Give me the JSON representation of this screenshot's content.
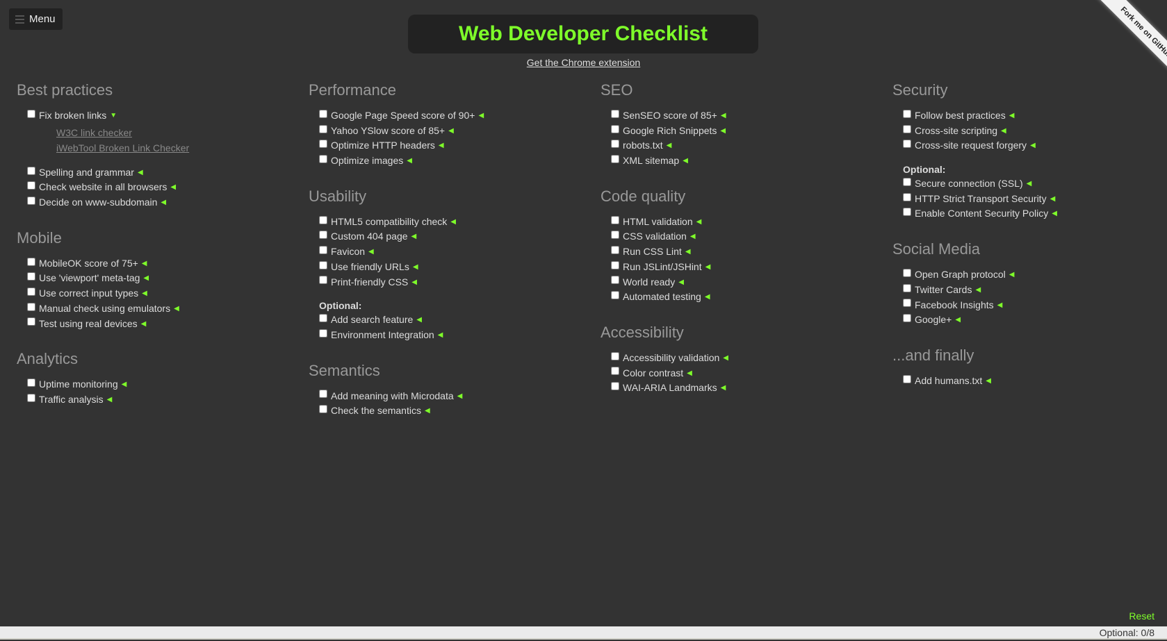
{
  "menu": {
    "label": "Menu",
    "icon": "list-icon"
  },
  "header": {
    "title": "Web Developer Checklist",
    "extension_link": "Get the Chrome extension"
  },
  "ribbon": {
    "label": "Fork me on GitHub"
  },
  "colors": {
    "accent": "#7fff2a",
    "background": "#333333",
    "heading": "#999999"
  },
  "columns": [
    [
      {
        "title": "Best practices",
        "items": [
          {
            "label": "Fix broken links",
            "expanded": true,
            "links": [
              "W3C link checker",
              "iWebTool Broken Link Checker"
            ]
          },
          {
            "label": "Spelling and grammar"
          },
          {
            "label": "Check website in all browsers"
          },
          {
            "label": "Decide on www-subdomain"
          }
        ]
      },
      {
        "title": "Mobile",
        "items": [
          {
            "label": "MobileOK score of 75+"
          },
          {
            "label": "Use 'viewport' meta-tag"
          },
          {
            "label": "Use correct input types"
          },
          {
            "label": "Manual check using emulators"
          },
          {
            "label": "Test using real devices"
          }
        ]
      },
      {
        "title": "Analytics",
        "items": [
          {
            "label": "Uptime monitoring"
          },
          {
            "label": "Traffic analysis"
          }
        ]
      }
    ],
    [
      {
        "title": "Performance",
        "items": [
          {
            "label": "Google Page Speed score of 90+"
          },
          {
            "label": "Yahoo YSlow score of 85+"
          },
          {
            "label": "Optimize HTTP headers"
          },
          {
            "label": "Optimize images"
          }
        ]
      },
      {
        "title": "Usability",
        "items": [
          {
            "label": "HTML5 compatibility check"
          },
          {
            "label": "Custom 404 page"
          },
          {
            "label": "Favicon"
          },
          {
            "label": "Use friendly URLs"
          },
          {
            "label": "Print-friendly CSS"
          }
        ],
        "optional_label": "Optional:",
        "optional": [
          {
            "label": "Add search feature"
          },
          {
            "label": "Environment Integration"
          }
        ]
      },
      {
        "title": "Semantics",
        "items": [
          {
            "label": "Add meaning with Microdata"
          },
          {
            "label": "Check the semantics"
          }
        ]
      }
    ],
    [
      {
        "title": "SEO",
        "items": [
          {
            "label": "SenSEO score of 85+"
          },
          {
            "label": "Google Rich Snippets"
          },
          {
            "label": "robots.txt"
          },
          {
            "label": "XML sitemap"
          }
        ]
      },
      {
        "title": "Code quality",
        "items": [
          {
            "label": "HTML validation"
          },
          {
            "label": "CSS validation"
          },
          {
            "label": "Run CSS Lint"
          },
          {
            "label": "Run JSLint/JSHint"
          },
          {
            "label": "World ready"
          },
          {
            "label": "Automated testing"
          }
        ]
      },
      {
        "title": "Accessibility",
        "items": [
          {
            "label": "Accessibility validation"
          },
          {
            "label": "Color contrast"
          },
          {
            "label": "WAI-ARIA Landmarks"
          }
        ]
      }
    ],
    [
      {
        "title": "Security",
        "items": [
          {
            "label": "Follow best practices"
          },
          {
            "label": "Cross-site scripting"
          },
          {
            "label": "Cross-site request forgery"
          }
        ],
        "optional_label": "Optional:",
        "optional": [
          {
            "label": "Secure connection (SSL)"
          },
          {
            "label": "HTTP Strict Transport Security"
          },
          {
            "label": "Enable Content Security Policy"
          }
        ]
      },
      {
        "title": "Social Media",
        "items": [
          {
            "label": "Open Graph protocol"
          },
          {
            "label": "Twitter Cards"
          },
          {
            "label": "Facebook Insights"
          },
          {
            "label": "Google+"
          }
        ]
      },
      {
        "title": "...and finally",
        "items": [
          {
            "label": "Add humans.txt"
          }
        ]
      }
    ]
  ],
  "footer": {
    "reset_label": "Reset",
    "status": "Optional: 0/8"
  }
}
